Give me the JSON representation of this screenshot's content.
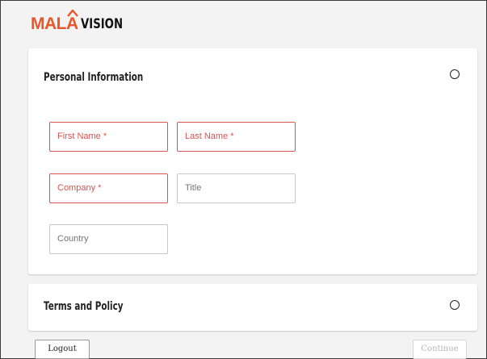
{
  "brand": {
    "logo_prefix": "MAL",
    "logo_a": "A",
    "logo_suffix": "VISION",
    "accent_color": "#e8572a"
  },
  "personal_section": {
    "title": "Personal Information",
    "status_icon": "circle-outline-icon",
    "fields": {
      "first_name": "First Name *",
      "last_name": "Last Name *",
      "company": "Company *",
      "title": "Title",
      "country": "Country"
    }
  },
  "terms_section": {
    "title": "Terms and Policy",
    "status_icon": "circle-outline-icon"
  },
  "footer": {
    "logout_label": "Logout",
    "continue_label": "Continue"
  },
  "colors": {
    "required": "#d9534f",
    "disabled_text": "#b5b5b5"
  }
}
